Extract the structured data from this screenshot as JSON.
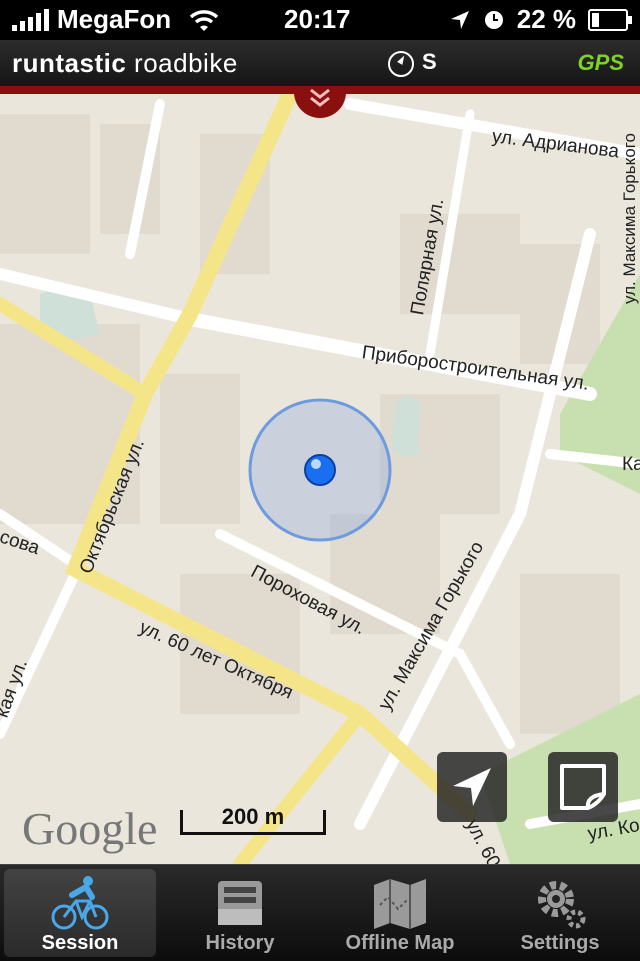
{
  "status": {
    "carrier": "MegaFon",
    "time": "20:17",
    "battery": "22 %",
    "battery_level": 0.22
  },
  "header": {
    "brand_bold": "runtastic",
    "brand_light": "roadbike",
    "heading": "S",
    "gps": "GPS"
  },
  "map": {
    "labels": {
      "adrianova": "ул. Адрианова",
      "polyarnaya": "Полярная ул.",
      "priborostroitelnaya": "Приборостроительная ул.",
      "oktyabrskaya": "Октябрьская ул.",
      "porokhovaya": "Пороховая ул.",
      "maksima_gorkogo": "ул. Максима Горького",
      "sixty_let": "ул. 60 лет Октября",
      "sixty_partial": "ул. 60",
      "sova": "сова",
      "kaya": "кая ул.",
      "ka": "Ка",
      "ul_ko": "ул. Ко",
      "right_vertical": "ул. Максима Горького"
    },
    "google_logo": "Google",
    "scale_label": "200 m"
  },
  "tabs": [
    {
      "label": "Session",
      "icon": "bicycle-icon",
      "active": true
    },
    {
      "label": "History",
      "icon": "archive-icon",
      "active": false
    },
    {
      "label": "Offline Map",
      "icon": "map-icon",
      "active": false
    },
    {
      "label": "Settings",
      "icon": "gear-icon",
      "active": false
    }
  ]
}
